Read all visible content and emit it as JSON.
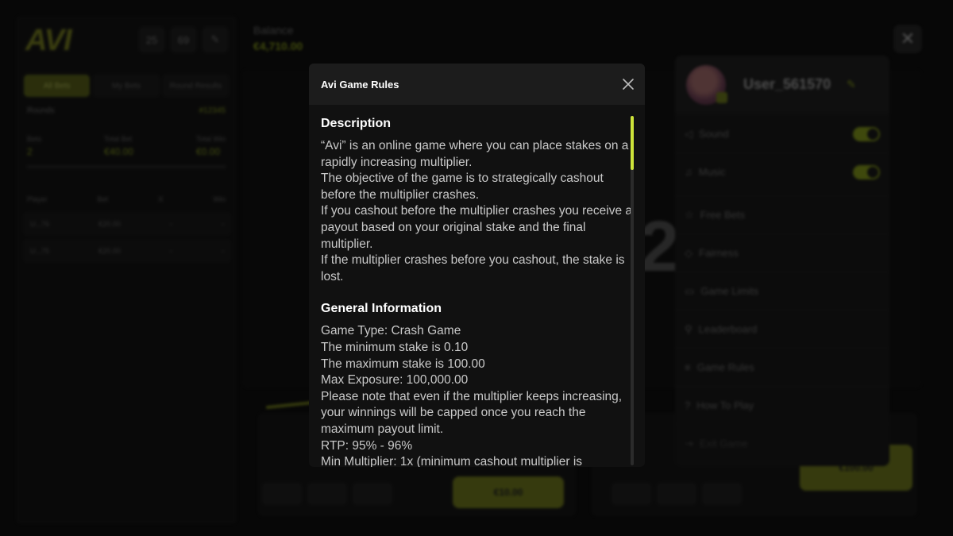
{
  "background": {
    "logo": "AVI",
    "header_buttons": [
      "25",
      "69",
      "✎"
    ],
    "tabs": [
      "All Bets",
      "My Bets",
      "Round Results"
    ],
    "rounds_label": "Rounds",
    "rounds_value": "#12345",
    "stats": [
      {
        "label": "Bets",
        "value": "2"
      },
      {
        "label": "Total Bet",
        "value": "€40.00"
      },
      {
        "label": "Total Win",
        "value": "€0.00"
      }
    ],
    "table_headers": [
      "Player",
      "Bet",
      "X",
      "Win"
    ],
    "table_rows": [
      {
        "player": "U...76",
        "bet": "€20.00",
        "x": "-",
        "win": "-"
      },
      {
        "player": "U...75",
        "bet": "€20.00",
        "x": "-",
        "win": "-"
      }
    ],
    "balance_label": "Balance",
    "balance_value": "€4,710.00",
    "multiplier": "2",
    "bet_cta_left": "€10.00",
    "bet_cta_right": "€100.00",
    "side_menu": {
      "username": "User_561570",
      "items": [
        {
          "label": "Sound",
          "icon": "speaker-icon",
          "toggle": true
        },
        {
          "label": "Music",
          "icon": "music-icon",
          "toggle": true
        },
        {
          "label": "Free Bets",
          "icon": "star-icon"
        },
        {
          "label": "Fairness",
          "icon": "shield-icon"
        },
        {
          "label": "Game Limits",
          "icon": "limits-icon"
        },
        {
          "label": "Leaderboard",
          "icon": "trophy-icon"
        },
        {
          "label": "Game Rules",
          "icon": "rules-icon"
        },
        {
          "label": "How To Play",
          "icon": "help-icon"
        },
        {
          "label": "Exit Game",
          "icon": "exit-icon"
        }
      ]
    }
  },
  "modal": {
    "title": "Avi Game Rules",
    "sections": [
      {
        "title": "Description",
        "lines": [
          "“Avi” is an online game where you can place stakes on a rapidly increasing multiplier.",
          "The objective of the game is to strategically cashout before the multiplier crashes.",
          "If you cashout before the multiplier crashes you receive a payout based on your original stake and the final multiplier.",
          "If the multiplier crashes before you cashout, the stake is lost."
        ]
      },
      {
        "title": "General Information",
        "lines": [
          "Game Type: Crash Game",
          "The minimum stake is 0.10",
          "The maximum stake is 100.00",
          "Max Exposure: 100,000.00",
          "Please note that even if the multiplier keeps increasing, your winnings will be capped once you reach the maximum payout limit.",
          "RTP: 95% - 96%",
          "Min Multiplier: 1x (minimum cashout multiplier is"
        ]
      }
    ]
  },
  "colors": {
    "accent": "#cde33a",
    "modal_bg": "#111111",
    "modal_header_bg": "#1c1c1c"
  }
}
